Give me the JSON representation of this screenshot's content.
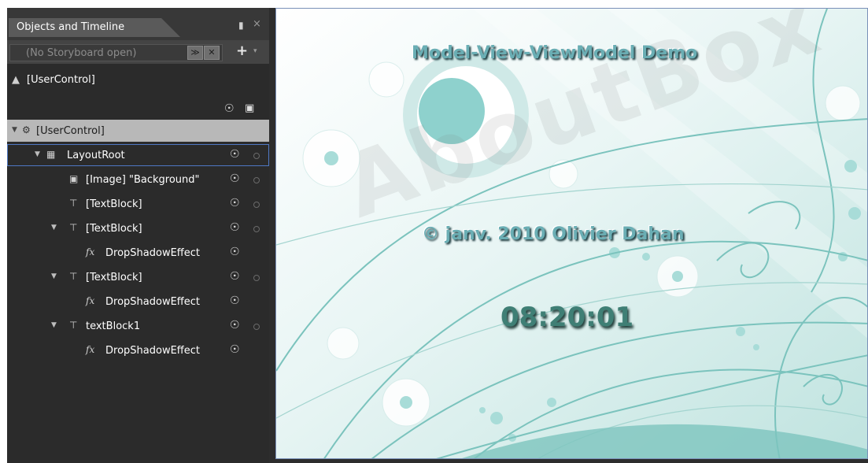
{
  "panel": {
    "title": "Objects and Timeline",
    "pin_icon": "pin-icon",
    "close_glyph": "×",
    "storyboard_placeholder": "(No Storyboard open)",
    "storyboard_btn1": "≫",
    "storyboard_btn2": "✕",
    "add_glyph": "+",
    "dropdown_glyph": "▾",
    "scope_label": "[UserControl]"
  },
  "tree": [
    {
      "label": "[UserControl]",
      "expander": "▼",
      "icon": "gear-icon",
      "icon_glyph": "⚙",
      "selected": true,
      "eye": false,
      "dot": false
    },
    {
      "label": "LayoutRoot",
      "expander": "▼",
      "icon": "grid-icon",
      "icon_glyph": "▦",
      "focused": true,
      "eye": true,
      "dot": true
    },
    {
      "label": "[Image] \"Background\"",
      "expander": "",
      "icon": "image-icon",
      "icon_glyph": "▣",
      "eye": true,
      "dot": true
    },
    {
      "label": "[TextBlock]",
      "expander": "",
      "icon": "textblock-icon",
      "icon_glyph": "⊤",
      "eye": true,
      "dot": true
    },
    {
      "label": "[TextBlock]",
      "expander": "▼",
      "icon": "textblock-icon",
      "icon_glyph": "⊤",
      "eye": true,
      "dot": true
    },
    {
      "label": "DropShadowEffect",
      "expander": "",
      "icon": "effect-icon",
      "icon_glyph": "fx",
      "eye": true,
      "dot": false
    },
    {
      "label": "[TextBlock]",
      "expander": "▼",
      "icon": "textblock-icon",
      "icon_glyph": "⊤",
      "eye": true,
      "dot": true
    },
    {
      "label": "DropShadowEffect",
      "expander": "",
      "icon": "effect-icon",
      "icon_glyph": "fx",
      "eye": true,
      "dot": false
    },
    {
      "label": "textBlock1",
      "expander": "▼",
      "icon": "textblock-icon",
      "icon_glyph": "⊤",
      "eye": true,
      "dot": true
    },
    {
      "label": "DropShadowEffect",
      "expander": "",
      "icon": "effect-icon",
      "icon_glyph": "fx",
      "eye": true,
      "dot": false
    }
  ],
  "artboard": {
    "title": "Model-View-ViewModel Demo",
    "copyright": "© janv. 2010 Olivier Dahan",
    "clock": "08:20:01",
    "watermark": "AboutBox"
  },
  "colors": {
    "panel_bg": "#2b2b2b",
    "selection": "#b8b8b8",
    "focus_border": "#4f78c4",
    "teal": "#6aaeb4"
  }
}
